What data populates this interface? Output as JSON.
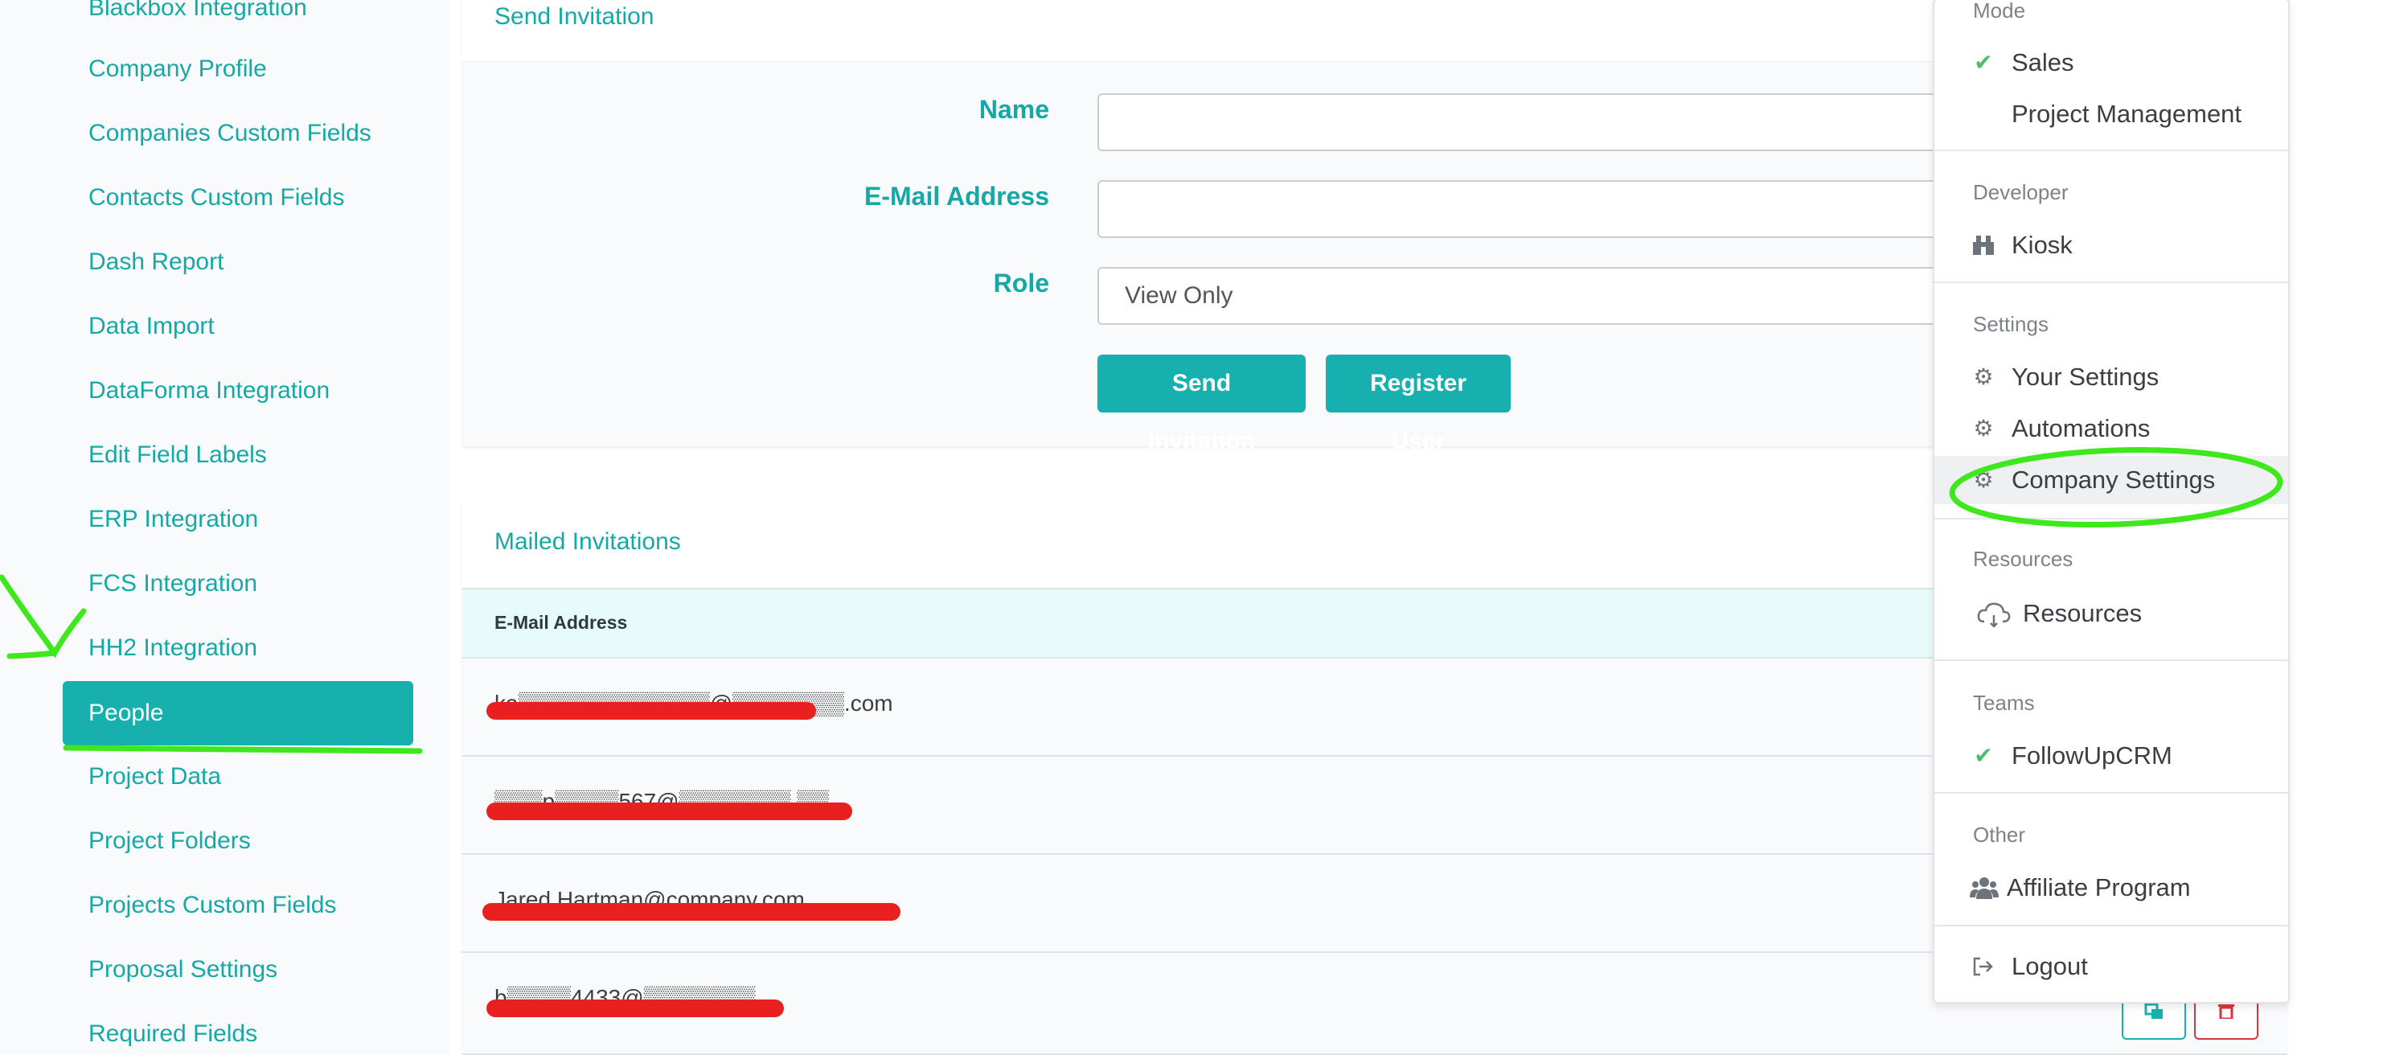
{
  "sidebar": {
    "items": [
      {
        "label": "Blackbox Integration"
      },
      {
        "label": "Company Profile"
      },
      {
        "label": "Companies Custom Fields"
      },
      {
        "label": "Contacts Custom Fields"
      },
      {
        "label": "Dash Report"
      },
      {
        "label": "Data Import"
      },
      {
        "label": "DataForma Integration"
      },
      {
        "label": "Edit Field Labels"
      },
      {
        "label": "ERP Integration"
      },
      {
        "label": "FCS Integration"
      },
      {
        "label": "HH2 Integration"
      },
      {
        "label": "People",
        "active": true
      },
      {
        "label": "Project Data"
      },
      {
        "label": "Project Folders"
      },
      {
        "label": "Projects Custom Fields"
      },
      {
        "label": "Proposal Settings"
      },
      {
        "label": "Required Fields"
      }
    ]
  },
  "invite_form": {
    "title": "Send Invitation",
    "name_label": "Name",
    "name_value": "",
    "email_label": "E-Mail Address",
    "email_value": "",
    "role_label": "Role",
    "role_value": "View Only",
    "send_button": "Send Invitation",
    "register_button": "Register User"
  },
  "mailed_invitations": {
    "title": "Mailed Invitations",
    "column_email": "E-Mail Address",
    "rows": [
      {
        "email": "ka▒▒▒▒▒▒▒▒▒▒▒▒@▒▒▒▒▒▒▒.com"
      },
      {
        "email": "▒▒▒p▒▒▒▒567@▒▒▒▒▒▒▒.▒▒"
      },
      {
        "email": "Jared Hartman@company.com"
      },
      {
        "email": "b▒▒▒▒4433@▒▒▒▒▒▒▒"
      }
    ]
  },
  "dropdown": {
    "sections": [
      {
        "header": "Mode",
        "items": [
          {
            "label": "Sales",
            "icon": "check-icon",
            "checked": true
          },
          {
            "label": "Project Management",
            "icon": ""
          }
        ]
      },
      {
        "header": "Developer",
        "items": [
          {
            "label": "Kiosk",
            "icon": "kiosk-icon"
          }
        ]
      },
      {
        "header": "Settings",
        "items": [
          {
            "label": "Your Settings",
            "icon": "gear-icon"
          },
          {
            "label": "Automations",
            "icon": "gear-icon"
          },
          {
            "label": "Company Settings",
            "icon": "gear-icon",
            "highlighted": true
          }
        ]
      },
      {
        "header": "Resources",
        "items": [
          {
            "label": "Resources",
            "icon": "cloud-icon"
          }
        ]
      },
      {
        "header": "Teams",
        "items": [
          {
            "label": "FollowUpCRM",
            "icon": "check-icon",
            "checked": true
          }
        ]
      },
      {
        "header": "Other",
        "items": [
          {
            "label": "Affiliate Program",
            "icon": "users-icon"
          },
          {
            "label": "Logout",
            "icon": "logout-icon"
          }
        ]
      }
    ]
  },
  "colors": {
    "accent": "#16b0ae",
    "accent_text": "#16a8a6",
    "annotation_green": "#3ee81c",
    "redaction_red": "#e82020",
    "delete_red": "#d9363e"
  }
}
